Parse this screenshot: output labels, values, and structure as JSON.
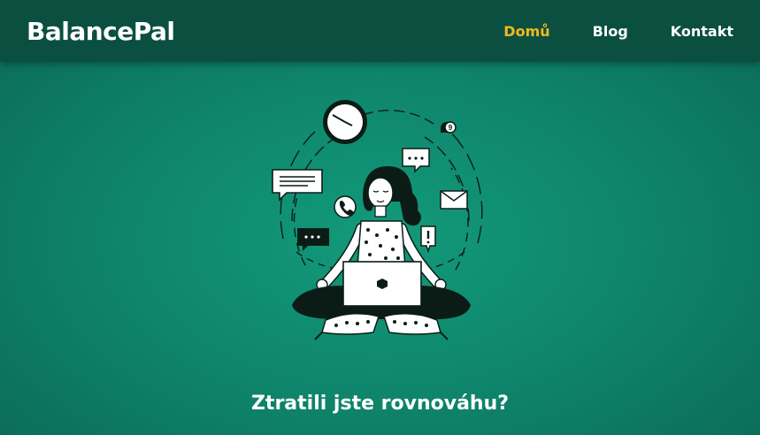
{
  "navbar": {
    "brand": "BalancePal",
    "links": [
      {
        "label": "Domů",
        "active": true
      },
      {
        "label": "Blog",
        "active": false
      },
      {
        "label": "Kontakt",
        "active": false
      }
    ]
  },
  "hero": {
    "headline": "Ztratili jste rovnováhu?",
    "illustration_icons": [
      "clock-icon",
      "notification-bell-icon",
      "chat-bubble-icon",
      "email-icon",
      "phone-icon",
      "alert-icon",
      "laptop-icon"
    ],
    "notification_count": "9"
  },
  "colors": {
    "background": "#0f876c",
    "navbar": "#0b4f40",
    "accent": "#f3b91d",
    "text": "#ffffff"
  }
}
